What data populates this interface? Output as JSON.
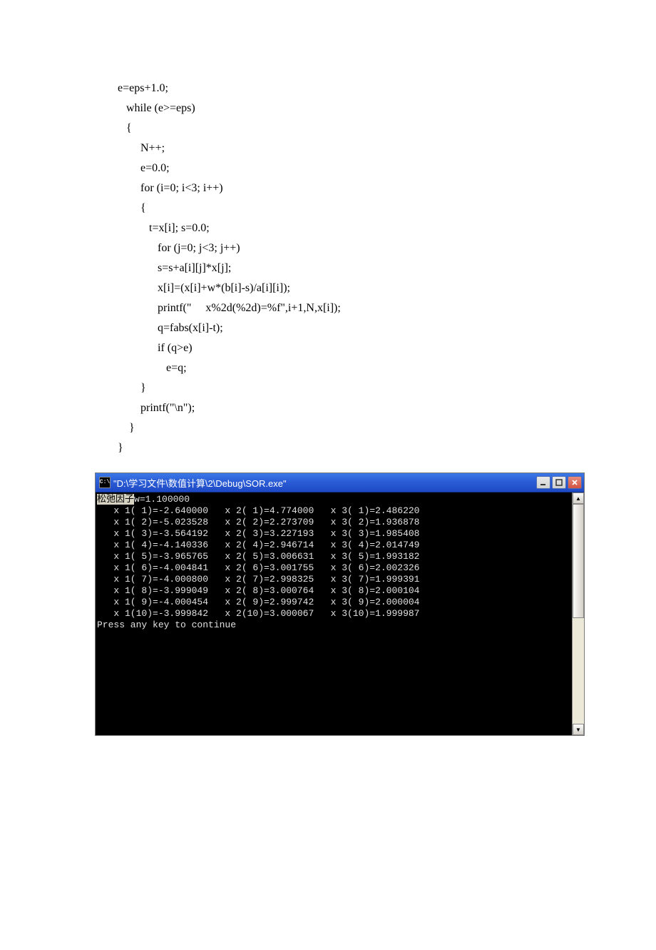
{
  "code": {
    "line1": "e=eps+1.0;",
    "line2": "   while (e>=eps)",
    "line3": "   {",
    "line4": "        N++;",
    "line5": "        e=0.0;",
    "line6": "        for (i=0; i<3; i++)",
    "line7": "        {",
    "line8": "           t=x[i]; s=0.0;",
    "line9": "              for (j=0; j<3; j++)",
    "line10": "              s=s+a[i][j]*x[j];",
    "line11": "              x[i]=(x[i]+w*(b[i]-s)/a[i][i]);",
    "line12": "              printf(\"     x%2d(%2d)=%f\",i+1,N,x[i]);",
    "line13": "              q=fabs(x[i]-t);",
    "line14": "              if (q>e)",
    "line15": "                 e=q;",
    "line16": "        }",
    "line17": "        printf(\"\\n\");",
    "line18": "    }",
    "line19": "}"
  },
  "window": {
    "icon_text": "C:\\",
    "title": "\"D:\\学习文件\\数值计算\\2\\Debug\\SOR.exe\""
  },
  "console": {
    "hl": "松弛因子",
    "w_line": "w=1.100000",
    "rows": [
      "   x 1( 1)=-2.640000   x 2( 1)=4.774000   x 3( 1)=2.486220",
      "   x 1( 2)=-5.023528   x 2( 2)=2.273709   x 3( 2)=1.936878",
      "   x 1( 3)=-3.564192   x 2( 3)=3.227193   x 3( 3)=1.985408",
      "   x 1( 4)=-4.140336   x 2( 4)=2.946714   x 3( 4)=2.014749",
      "   x 1( 5)=-3.965765   x 2( 5)=3.006631   x 3( 5)=1.993182",
      "   x 1( 6)=-4.004841   x 2( 6)=3.001755   x 3( 6)=2.002326",
      "   x 1( 7)=-4.000800   x 2( 7)=2.998325   x 3( 7)=1.999391",
      "   x 1( 8)=-3.999049   x 2( 8)=3.000764   x 3( 8)=2.000104",
      "   x 1( 9)=-4.000454   x 2( 9)=2.999742   x 3( 9)=2.000004",
      "   x 1(10)=-3.999842   x 2(10)=3.000067   x 3(10)=1.999987"
    ],
    "press": "Press any key to continue"
  }
}
